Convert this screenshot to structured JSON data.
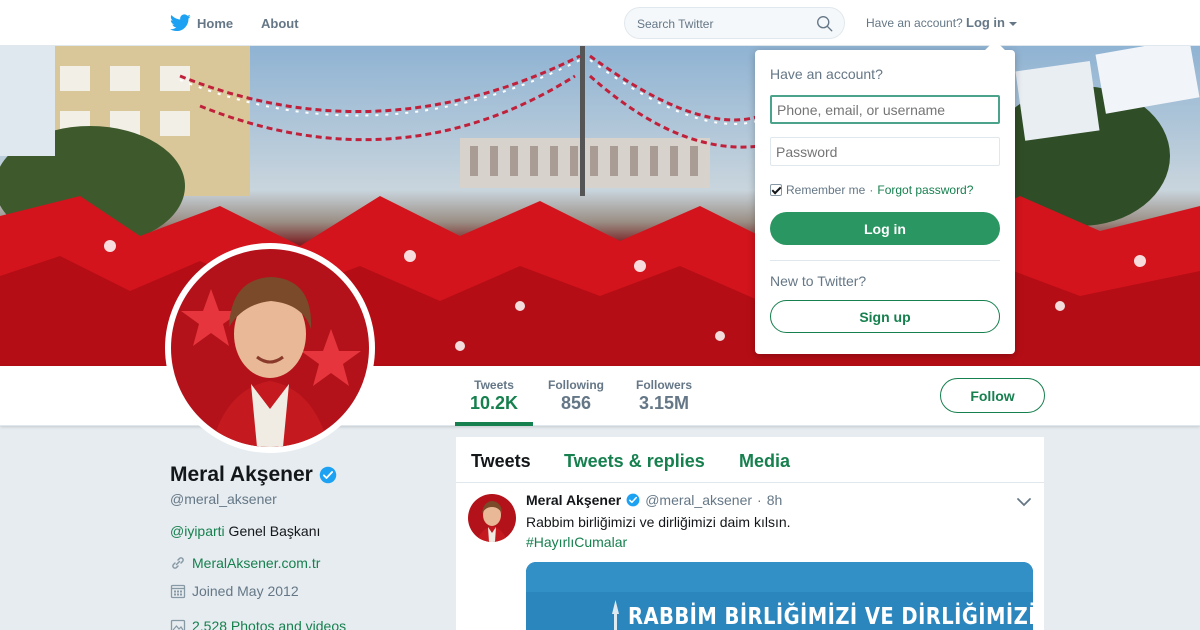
{
  "nav": {
    "home_label": "Home",
    "about_label": "About",
    "search_placeholder": "Search Twitter",
    "have_account": "Have an account?",
    "login_label": "Log in"
  },
  "profile": {
    "name": "Meral Akşener",
    "handle": "@meral_aksener",
    "bio_mention": "@iyiparti",
    "bio_text": " Genel Başkanı",
    "website": "MeralAksener.com.tr",
    "joined": "Joined May 2012",
    "photos": "2,528 Photos and videos",
    "follow_label": "Follow",
    "stats": [
      {
        "label": "Tweets",
        "value": "10.2K"
      },
      {
        "label": "Following",
        "value": "856"
      },
      {
        "label": "Followers",
        "value": "3.15M"
      }
    ]
  },
  "timeline": {
    "tabs": [
      "Tweets",
      "Tweets & replies",
      "Media"
    ],
    "tweet": {
      "name": "Meral Akşener",
      "handle": "@meral_aksener",
      "separator": "·",
      "time": "8h",
      "text": "Rabbim birliğimizi ve dirliğimizi daim kılsın.",
      "hashtag": "#HayırlıCumalar",
      "media_caption": "RABBİM BİRLİĞİMİZİ VE DİRLİĞİMİZİ DAİM KILSIN"
    }
  },
  "login_dropdown": {
    "title": "Have an account?",
    "username_placeholder": "Phone, email, or username",
    "password_placeholder": "Password",
    "remember_label": "Remember me",
    "separator": " · ",
    "forgot_label": "Forgot password?",
    "login_button": "Log in",
    "new_label": "New to Twitter?",
    "signup_button": "Sign up"
  },
  "colors": {
    "accent": "#17804f",
    "verified": "#1da1f2",
    "twitter_blue": "#1da1f2"
  },
  "icons": [
    "twitter-bird-icon",
    "search-icon",
    "caret-down-icon",
    "verified-icon",
    "link-icon",
    "calendar-icon",
    "photo-icon",
    "chevron-down-icon",
    "checkbox-icon"
  ]
}
